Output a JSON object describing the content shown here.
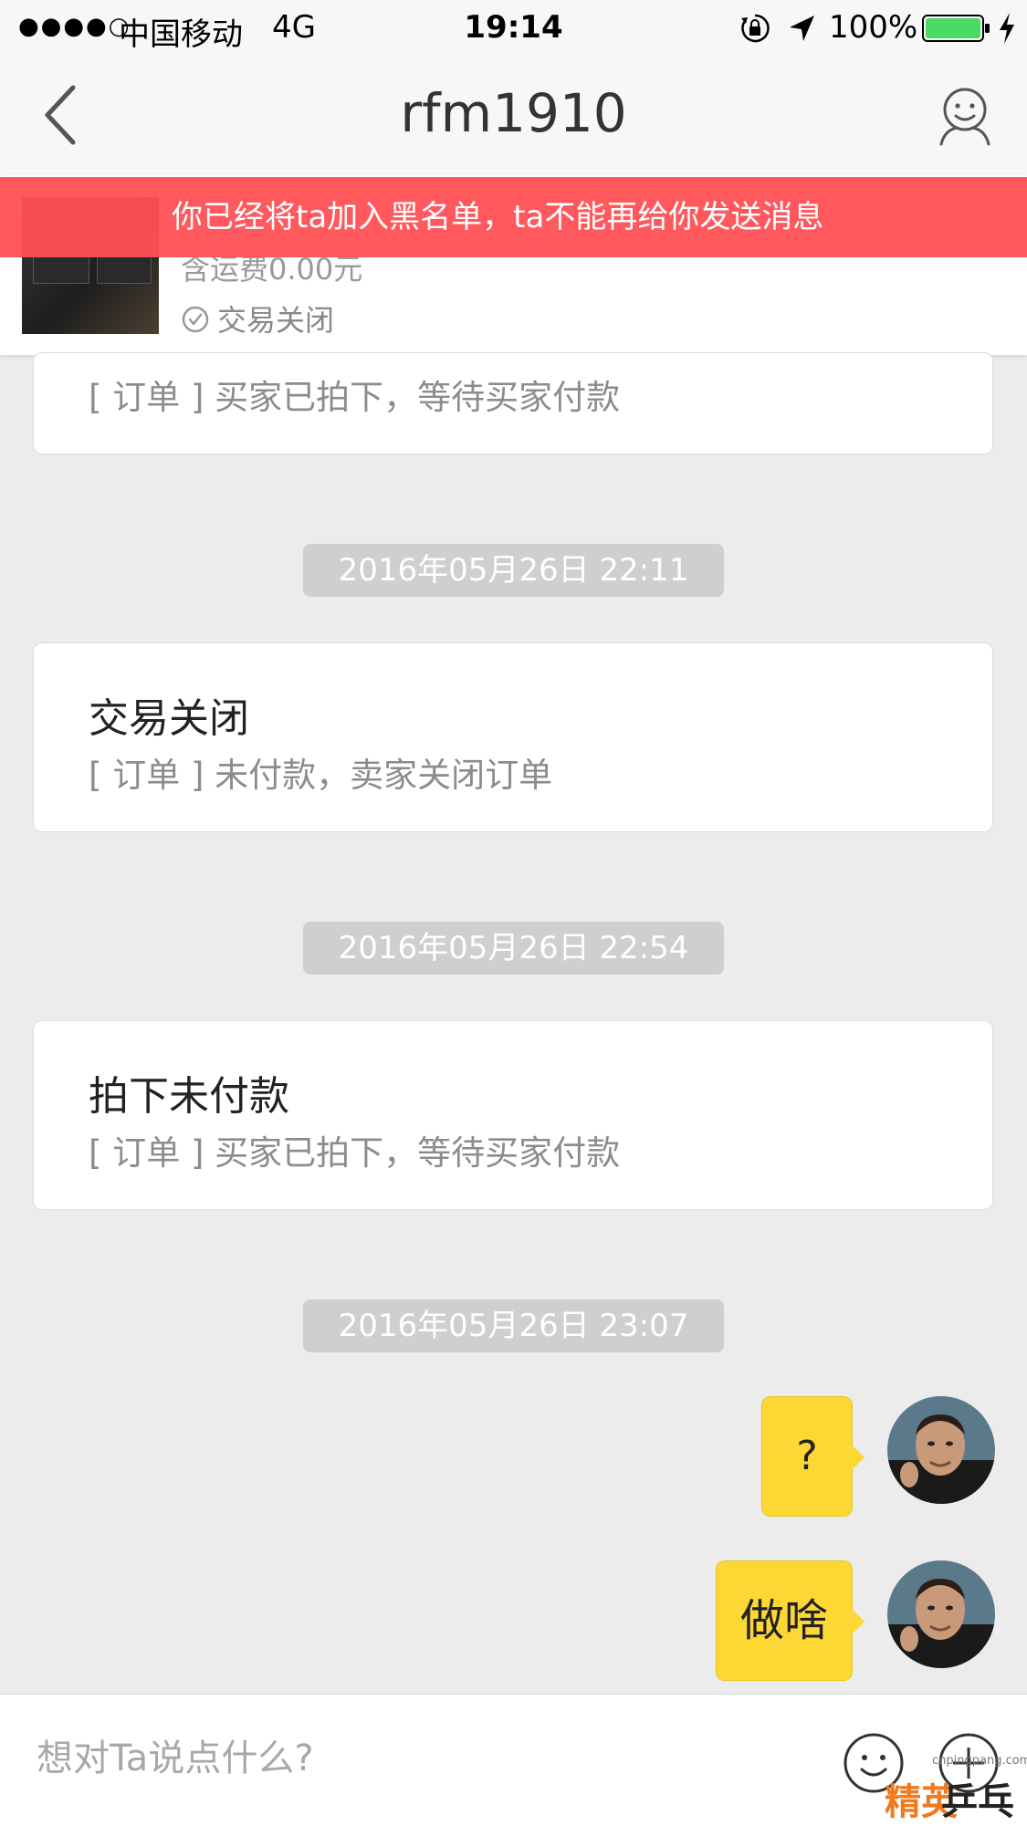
{
  "status_bar": {
    "signal": "●●●●○",
    "carrier": "中国移动",
    "network": "4G",
    "time": "19:14",
    "battery": "100%"
  },
  "nav": {
    "title": "rfm1910"
  },
  "product": {
    "shipping": "含运费0.00元",
    "status": "交易关闭"
  },
  "banner": {
    "text": "你已经将ta加入黑名单，ta不能再给你发送消息"
  },
  "messages": {
    "card0": {
      "desc": "[ 订单 ] 买家已拍下，等待买家付款"
    },
    "ts1": "2016年05月26日 22:11",
    "card1": {
      "title": "交易关闭",
      "desc": "[ 订单 ] 未付款，卖家关闭订单"
    },
    "ts2": "2016年05月26日 22:54",
    "card2": {
      "title": "拍下未付款",
      "desc": "[ 订单 ] 买家已拍下，等待买家付款"
    },
    "ts3": "2016年05月26日 23:07",
    "bubble1": "?",
    "bubble2": "做啥"
  },
  "input": {
    "placeholder": "想对Ta说点什么?"
  },
  "watermark": {
    "url": "cnpingpang.com",
    "text_a": "精英",
    "text_b": "乒乓网"
  },
  "colors": {
    "banner": "#ff5055",
    "bubble": "#fdd835",
    "battery": "#4cd964"
  }
}
